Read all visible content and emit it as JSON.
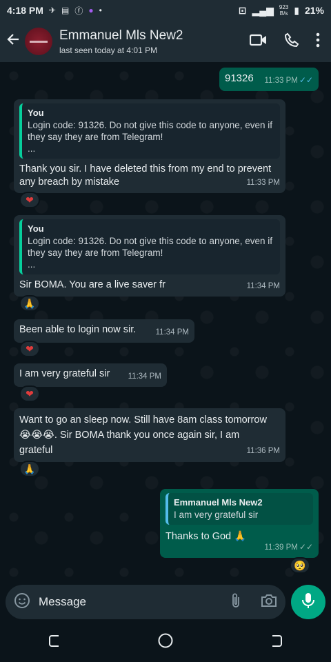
{
  "status_bar": {
    "time": "4:18 PM",
    "speed_value": "923",
    "speed_unit": "B/s",
    "battery": "21%"
  },
  "header": {
    "contact_name": "Emmanuel Mls New2",
    "last_seen": "last seen today at 4:01 PM"
  },
  "messages": [
    {
      "text": "91326",
      "time": "11:33 PM"
    },
    {
      "quote_name": "You",
      "quote_text": "Login code: 91326. Do not give this code to anyone, even if they say they are from Telegram!",
      "quote_more": "...",
      "text": "Thank you sir. I have deleted this from my end to prevent any breach by mistake",
      "time": "11:33 PM",
      "reaction": "❤"
    },
    {
      "quote_name": "You",
      "quote_text": "Login code: 91326. Do not give this code to anyone, even if they say they are from Telegram!",
      "quote_more": "...",
      "text": "Sir BOMA. You are a live saver fr",
      "time": "11:34 PM",
      "reaction": "🙏"
    },
    {
      "text": "Been able to login now sir.",
      "time": "11:34 PM",
      "reaction": "❤"
    },
    {
      "text": "I am very grateful sir",
      "time": "11:34 PM",
      "reaction": "❤"
    },
    {
      "text": "Want to go an sleep now. Still have 8am class tomorrow 😭😭😭. Sir BOMA thank you once again sir, I am grateful",
      "time": "11:36 PM",
      "reaction": "🙏"
    },
    {
      "quote_name": "Emmanuel Mls New2",
      "quote_text": "I am very grateful sir",
      "text": "Thanks to God 🙏",
      "time": "11:39 PM",
      "reaction": "🥺"
    }
  ],
  "composer": {
    "placeholder": "Message"
  },
  "colors": {
    "background": "#0b141a",
    "incoming_bubble": "#1f2c34",
    "outgoing_bubble": "#005c4b",
    "accent": "#00a884"
  }
}
